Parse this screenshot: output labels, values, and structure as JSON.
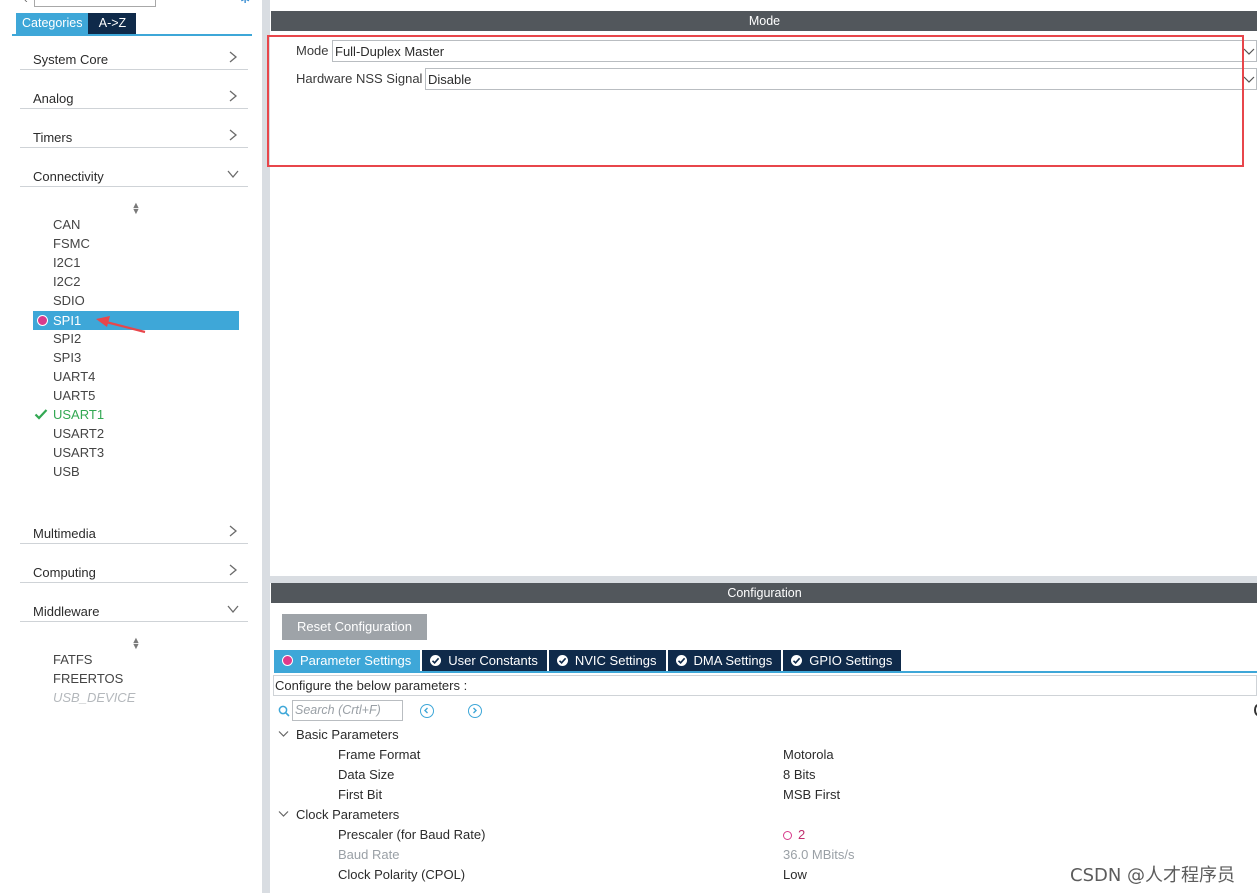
{
  "left_panel": {
    "view_tabs": [
      "Categories",
      "A->Z"
    ],
    "categories": [
      {
        "label": "System Core",
        "expanded": false
      },
      {
        "label": "Analog",
        "expanded": false
      },
      {
        "label": "Timers",
        "expanded": false
      },
      {
        "label": "Connectivity",
        "expanded": true
      },
      {
        "label": "Multimedia",
        "expanded": false
      },
      {
        "label": "Computing",
        "expanded": false
      },
      {
        "label": "Middleware",
        "expanded": true
      }
    ],
    "connectivity_items": [
      "CAN",
      "FSMC",
      "I2C1",
      "I2C2",
      "SDIO",
      "SPI1",
      "SPI2",
      "SPI3",
      "UART4",
      "UART5",
      "USART1",
      "USART2",
      "USART3",
      "USB"
    ],
    "selected_item": "SPI1",
    "configured_item": "USART1",
    "middleware_items": [
      "FATFS",
      "FREERTOS",
      "USB_DEVICE"
    ],
    "disabled_item": "USB_DEVICE"
  },
  "main": {
    "mode_section": {
      "title": "Mode",
      "fields": [
        {
          "label": "Mode",
          "value": "Full-Duplex Master"
        },
        {
          "label": "Hardware NSS Signal",
          "value": "Disable"
        }
      ]
    },
    "config_section": {
      "title": "Configuration",
      "reset_label": "Reset Configuration",
      "tabs": [
        {
          "label": "Parameter Settings",
          "status": "error",
          "active": true
        },
        {
          "label": "User Constants",
          "status": "ok",
          "active": false
        },
        {
          "label": "NVIC Settings",
          "status": "ok",
          "active": false
        },
        {
          "label": "DMA Settings",
          "status": "ok",
          "active": false
        },
        {
          "label": "GPIO Settings",
          "status": "ok",
          "active": false
        }
      ],
      "hint": "Configure the below parameters :",
      "search_placeholder": "Search (Crtl+F)",
      "groups": [
        {
          "name": "Basic Parameters",
          "params": [
            {
              "name": "Frame Format",
              "value": "Motorola"
            },
            {
              "name": "Data Size",
              "value": "8 Bits"
            },
            {
              "name": "First Bit",
              "value": "MSB First"
            }
          ]
        },
        {
          "name": "Clock Parameters",
          "params": [
            {
              "name": "Prescaler (for Baud Rate)",
              "value": "2",
              "status": "error"
            },
            {
              "name": "Baud Rate",
              "value": "36.0 MBits/s",
              "muted": true
            },
            {
              "name": "Clock Polarity (CPOL)",
              "value": "Low"
            }
          ]
        }
      ]
    }
  },
  "watermark": "CSDN @人才程序员",
  "colors": {
    "accent": "#3ea7d8",
    "navy": "#0f2a4a",
    "section_bar": "#52575c",
    "highlight_box": "#e8464b",
    "error_pink": "#e03a8b",
    "ok_green": "#33a853"
  }
}
